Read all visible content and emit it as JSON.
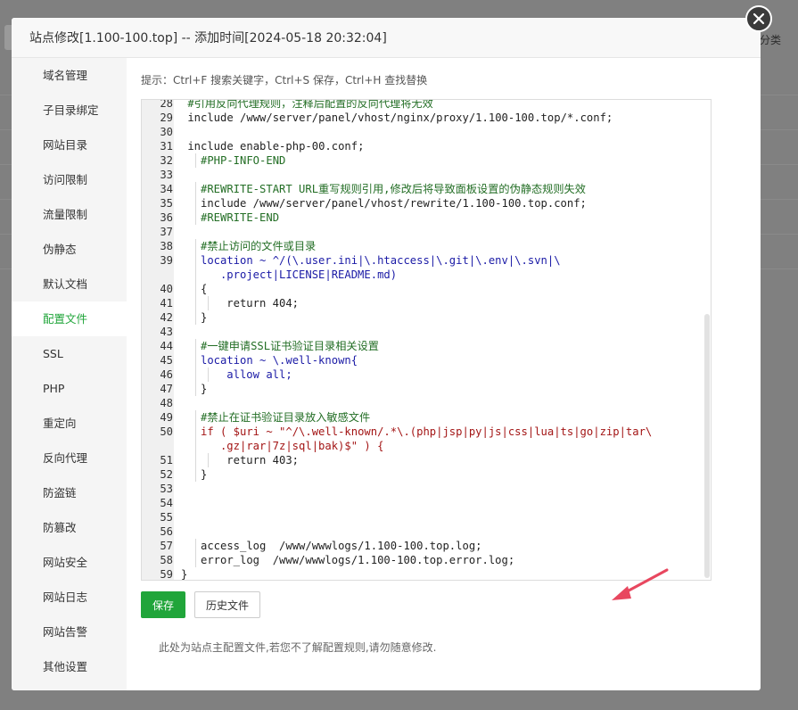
{
  "background": {
    "right_text": "部分类"
  },
  "modal": {
    "title": "站点修改[1.100-100.top] -- 添加时间[2024-05-18 20:32:04]",
    "close_icon": "close-icon"
  },
  "sidebar": {
    "items": [
      {
        "label": "域名管理",
        "active": false
      },
      {
        "label": "子目录绑定",
        "active": false
      },
      {
        "label": "网站目录",
        "active": false
      },
      {
        "label": "访问限制",
        "active": false
      },
      {
        "label": "流量限制",
        "active": false
      },
      {
        "label": "伪静态",
        "active": false
      },
      {
        "label": "默认文档",
        "active": false
      },
      {
        "label": "配置文件",
        "active": true
      },
      {
        "label": "SSL",
        "active": false
      },
      {
        "label": "PHP",
        "active": false
      },
      {
        "label": "重定向",
        "active": false
      },
      {
        "label": "反向代理",
        "active": false
      },
      {
        "label": "防盗链",
        "active": false
      },
      {
        "label": "防篡改",
        "active": false
      },
      {
        "label": "网站安全",
        "active": false
      },
      {
        "label": "网站日志",
        "active": false
      },
      {
        "label": "网站告警",
        "active": false
      },
      {
        "label": "其他设置",
        "active": false
      }
    ]
  },
  "hint": "提示：Ctrl+F 搜索关键字，Ctrl+S 保存，Ctrl+H 查找替换",
  "editor": {
    "lines": [
      {
        "n": "28",
        "text": "#引用反向代理规则，注释后配置的反向代理将无效",
        "type": "comment",
        "indent": 1
      },
      {
        "n": "29",
        "text": "include /www/server/panel/vhost/nginx/proxy/1.100-100.top/*.conf;",
        "type": "plain",
        "indent": 1
      },
      {
        "n": "30",
        "text": "",
        "type": "plain",
        "indent": 1
      },
      {
        "n": "31",
        "text": "include enable-php-00.conf;",
        "type": "plain",
        "indent": 1
      },
      {
        "n": "32",
        "text": "#PHP-INFO-END",
        "type": "comment",
        "indent": 2
      },
      {
        "n": "33",
        "text": "",
        "type": "plain",
        "indent": 1
      },
      {
        "n": "34",
        "text": "#REWRITE-START URL重写规则引用,修改后将导致面板设置的伪静态规则失效",
        "type": "comment",
        "indent": 2
      },
      {
        "n": "35",
        "text": "include /www/server/panel/vhost/rewrite/1.100-100.top.conf;",
        "type": "plain",
        "indent": 2
      },
      {
        "n": "36",
        "text": "#REWRITE-END",
        "type": "comment",
        "indent": 2
      },
      {
        "n": "37",
        "text": "",
        "type": "plain",
        "indent": 1
      },
      {
        "n": "38",
        "text": "#禁止访问的文件或目录",
        "type": "comment",
        "indent": 2
      },
      {
        "n": "39",
        "text": "location ~ ^/(\\.user.ini|\\.htaccess|\\.git|\\.env|\\.svn|\\",
        "type": "location",
        "indent": 2
      },
      {
        "n": "",
        "text": ".project|LICENSE|README.md)",
        "type": "kwcont",
        "indent": 2
      },
      {
        "n": "40",
        "text": "{",
        "type": "plain",
        "indent": 2
      },
      {
        "n": "41",
        "text": "return 404;",
        "type": "return",
        "indent": 3
      },
      {
        "n": "42",
        "text": "}",
        "type": "plain",
        "indent": 2
      },
      {
        "n": "43",
        "text": "",
        "type": "plain",
        "indent": 1
      },
      {
        "n": "44",
        "text": "#一键申请SSL证书验证目录相关设置",
        "type": "comment",
        "indent": 2
      },
      {
        "n": "45",
        "text": "location ~ \\.well-known{",
        "type": "location2",
        "indent": 2
      },
      {
        "n": "46",
        "text": "allow all;",
        "type": "allow",
        "indent": 3
      },
      {
        "n": "47",
        "text": "}",
        "type": "plain",
        "indent": 2
      },
      {
        "n": "48",
        "text": "",
        "type": "plain",
        "indent": 1
      },
      {
        "n": "49",
        "text": "#禁止在证书验证目录放入敏感文件",
        "type": "comment",
        "indent": 2
      },
      {
        "n": "50",
        "text": "if ( $uri ~ \"^/\\.well-known/.*\\.(php|jsp|py|js|css|lua|ts|go|zip|tar\\",
        "type": "if",
        "indent": 2
      },
      {
        "n": "",
        "text": ".gz|rar|7z|sql|bak)$\" ) {",
        "type": "strcont",
        "indent": 2
      },
      {
        "n": "51",
        "text": "return 403;",
        "type": "return",
        "indent": 3
      },
      {
        "n": "52",
        "text": "}",
        "type": "plain",
        "indent": 2
      },
      {
        "n": "53",
        "text": "",
        "type": "plain",
        "indent": 1
      },
      {
        "n": "54",
        "text": "",
        "type": "plain",
        "indent": 1
      },
      {
        "n": "55",
        "text": "",
        "type": "plain",
        "indent": 1
      },
      {
        "n": "56",
        "text": "",
        "type": "plain",
        "indent": 1
      },
      {
        "n": "57",
        "text": "access_log  /www/wwwlogs/1.100-100.top.log;",
        "type": "log",
        "indent": 2
      },
      {
        "n": "58",
        "text": "error_log  /www/wwwlogs/1.100-100.top.error.log;",
        "type": "log",
        "indent": 2
      },
      {
        "n": "59",
        "text": "}",
        "type": "plain",
        "indent": 0
      }
    ]
  },
  "buttons": {
    "save": "保存",
    "history": "历史文件"
  },
  "footnote": "此处为站点主配置文件,若您不了解配置规则,请勿随意修改.",
  "colors": {
    "accent": "#20a53a",
    "arrow": "#e8475f"
  }
}
